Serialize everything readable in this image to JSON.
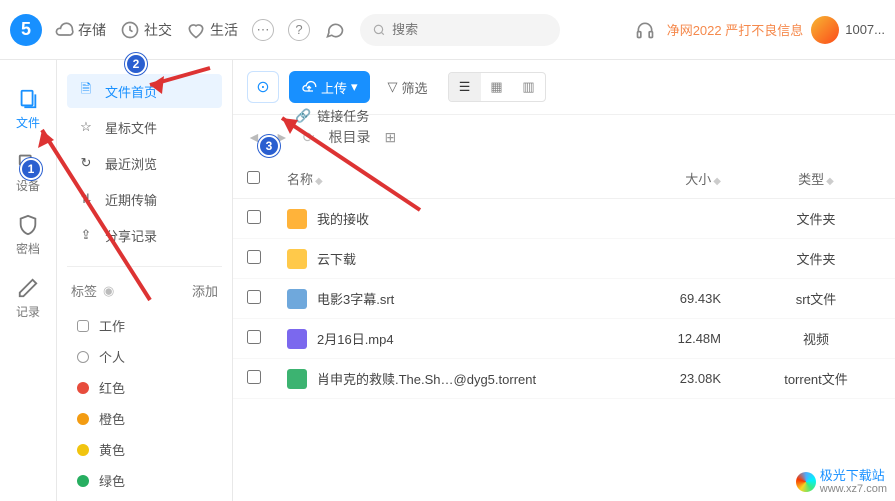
{
  "top": {
    "storage": "存储",
    "social": "社交",
    "life": "生活",
    "search_placeholder": "搜索",
    "notice": "净网2022 严打不良信息",
    "uid": "1007..."
  },
  "rail": {
    "files": "文件",
    "devices": "设备",
    "safe": "密档",
    "records": "记录"
  },
  "sidebar": {
    "items": [
      {
        "icon": "file",
        "label": "文件首页"
      },
      {
        "icon": "star",
        "label": "星标文件"
      },
      {
        "icon": "clock",
        "label": "最近浏览"
      },
      {
        "icon": "transfer",
        "label": "近期传输"
      },
      {
        "icon": "share",
        "label": "分享记录"
      }
    ],
    "tag_title": "标签",
    "tag_add": "添加",
    "tags": [
      {
        "label": "工作",
        "type": "outline"
      },
      {
        "label": "个人",
        "type": "outline-user"
      },
      {
        "label": "红色",
        "color": "#e74c3c"
      },
      {
        "label": "橙色",
        "color": "#f39c12"
      },
      {
        "label": "黄色",
        "color": "#f1c40f"
      },
      {
        "label": "绿色",
        "color": "#27ae60"
      }
    ]
  },
  "toolbar": {
    "upload": "上传",
    "filter": "筛选",
    "link_task": "链接任务",
    "root": "根目录"
  },
  "table": {
    "col_name": "名称",
    "col_size": "大小",
    "col_type": "类型",
    "rows": [
      {
        "icon": "folder-o",
        "name": "我的接收",
        "size": "",
        "type": "文件夹"
      },
      {
        "icon": "folder-y",
        "name": "云下载",
        "size": "",
        "type": "文件夹"
      },
      {
        "icon": "srt",
        "name": "电影3字幕.srt",
        "size": "69.43K",
        "type": "srt文件"
      },
      {
        "icon": "video",
        "name": "2月16日.mp4",
        "size": "12.48M",
        "type": "视频"
      },
      {
        "icon": "torrent",
        "name": "肖申克的救赎.The.Sh…@dyg5.torrent",
        "size": "23.08K",
        "type": "torrent文件"
      }
    ]
  },
  "watermark": {
    "name": "极光下载站",
    "url": "www.xz7.com"
  },
  "annotations": {
    "n1": "1",
    "n2": "2",
    "n3": "3"
  }
}
